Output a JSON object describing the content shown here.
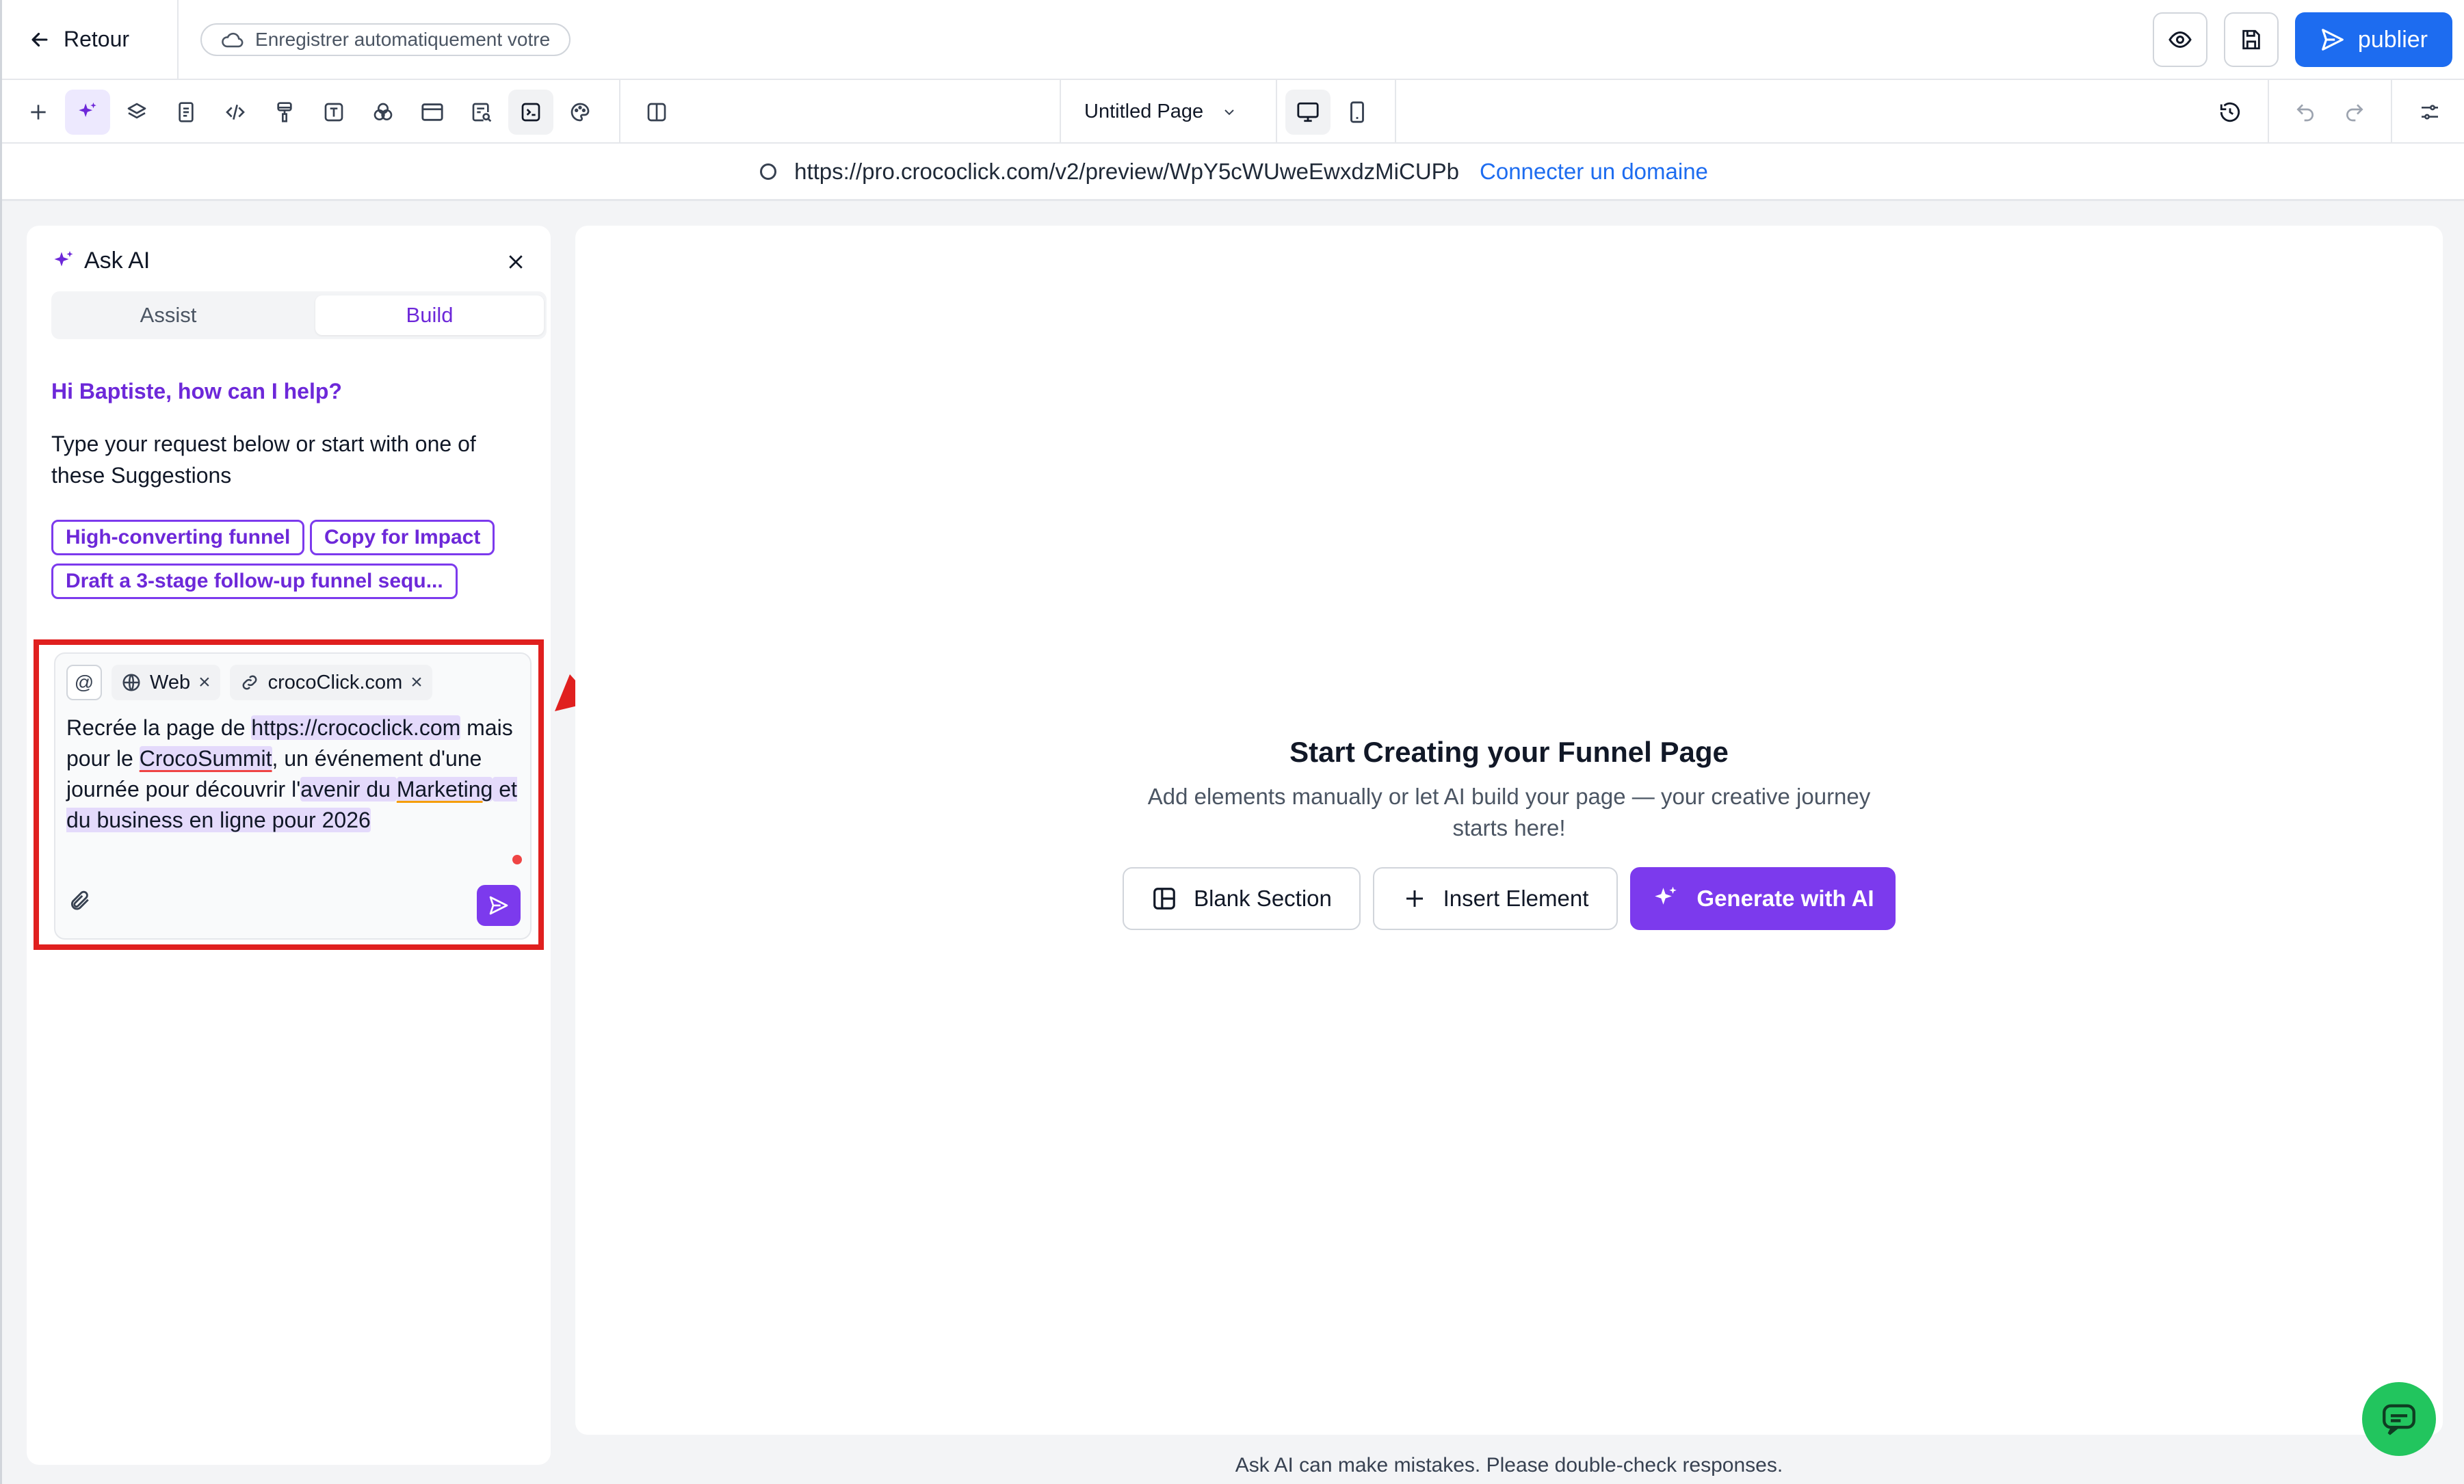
{
  "topbar": {
    "back_label": "Retour",
    "autosave_label": "Enregistrer automatiquement votre",
    "publish_label": "publier"
  },
  "toolbar": {
    "page_name": "Untitled Page",
    "tools": [
      "add-icon",
      "sparkles-icon",
      "layers-icon",
      "pages-icon",
      "code-icon",
      "brush-icon",
      "text-icon",
      "shapes-icon",
      "layout-icon",
      "seo-icon",
      "terminal-icon",
      "palette-icon",
      "columns-icon"
    ]
  },
  "urlbar": {
    "url": "https://pro.crococlick.com/v2/preview/WpY5cWUweEwxdzMiCUPb",
    "link_label": "Connecter un domaine"
  },
  "ai_panel": {
    "title": "Ask AI",
    "tabs": {
      "assist": "Assist",
      "build": "Build"
    },
    "greeting": "Hi Baptiste, how can I help?",
    "intro": "Type your request below or start with one of these Suggestions",
    "suggestions": [
      "High-converting funnel",
      "Copy for Impact",
      "Draft a 3-stage follow-up funnel sequ..."
    ],
    "prompt": {
      "at_symbol": "@",
      "tags": [
        "Web",
        "crocoClick.com"
      ],
      "text": {
        "p1": "Recrée la page de ",
        "h1": "https://crococlick.com",
        "p2": " mais pour le ",
        "h2": "CrocoSummit",
        "p3": ", un événement d'une journée pour découvrir l'",
        "h3a": "avenir du ",
        "h3b": "Marketing",
        "h3c": " et du business en ligne pour 2026"
      }
    }
  },
  "canvas": {
    "title": "Start Creating your Funnel Page",
    "description": "Add elements manually or let AI build your page — your creative journey starts here!",
    "buttons": {
      "blank": "Blank Section",
      "insert": "Insert Element",
      "generate": "Generate with AI"
    }
  },
  "disclaimer": "Ask AI can make mistakes. Please double-check responses.",
  "colors": {
    "accent": "#7c3aed",
    "primary": "#1d6cf0",
    "highlight": "#e0201f",
    "chat": "#22c55e"
  }
}
